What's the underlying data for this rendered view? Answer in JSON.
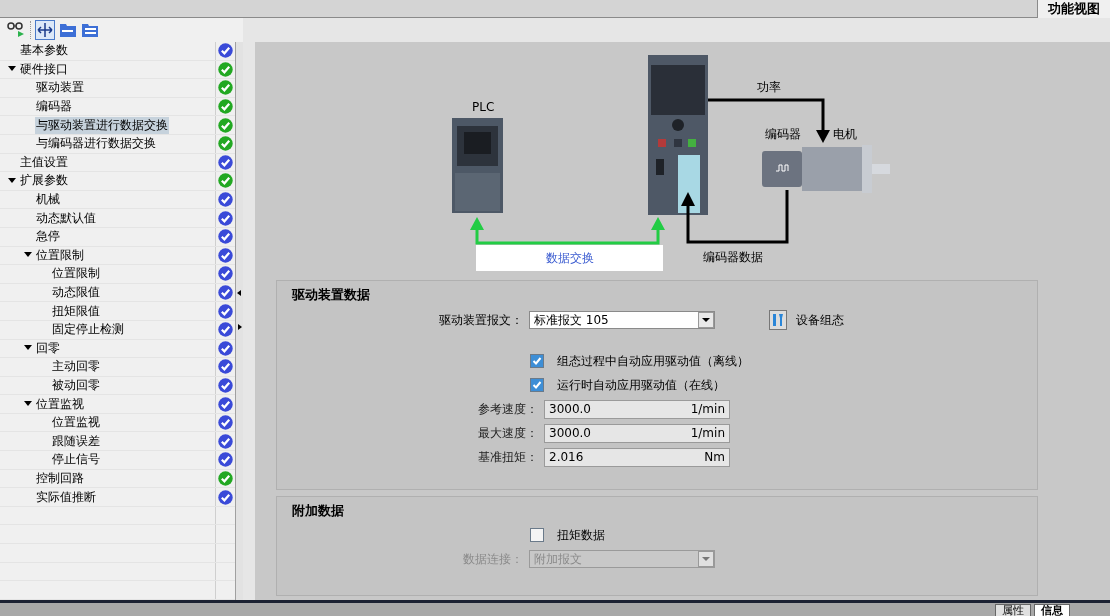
{
  "view_tab": {
    "label": "功能视图",
    "selected": true
  },
  "tree": [
    {
      "label": "基本参数",
      "color": "#3a4ad8",
      "selected": false
    },
    {
      "label": "硬件接口",
      "color": "#22a822",
      "selected": false,
      "expanded": true,
      "children": [
        {
          "label": "驱动装置",
          "color": "#22a822",
          "selected": false
        },
        {
          "label": "编码器",
          "color": "#22a822",
          "selected": false
        },
        {
          "label": "与驱动装置进行数据交换",
          "color": "#22a822",
          "selected": true
        },
        {
          "label": "与编码器进行数据交换",
          "color": "#22a822",
          "selected": false
        }
      ]
    },
    {
      "label": "主值设置",
      "color": "#3a4ad8",
      "selected": false
    },
    {
      "label": "扩展参数",
      "color": "#22a822",
      "selected": false,
      "expanded": true,
      "children": [
        {
          "label": "机械",
          "color": "#3a4ad8",
          "selected": false
        },
        {
          "label": "动态默认值",
          "color": "#3a4ad8",
          "selected": false
        },
        {
          "label": "急停",
          "color": "#3a4ad8",
          "selected": false
        },
        {
          "label": "位置限制",
          "color": "#3a4ad8",
          "selected": false,
          "expanded": true,
          "children": [
            {
              "label": "位置限制",
              "color": "#3a4ad8",
              "selected": false
            },
            {
              "label": "动态限值",
              "color": "#3a4ad8",
              "selected": false
            },
            {
              "label": "扭矩限值",
              "color": "#3a4ad8",
              "selected": false
            },
            {
              "label": "固定停止检测",
              "color": "#3a4ad8",
              "selected": false
            }
          ]
        },
        {
          "label": "回零",
          "color": "#3a4ad8",
          "selected": false,
          "expanded": true,
          "children": [
            {
              "label": "主动回零",
              "color": "#3a4ad8",
              "selected": false
            },
            {
              "label": "被动回零",
              "color": "#3a4ad8",
              "selected": false
            }
          ]
        },
        {
          "label": "位置监视",
          "color": "#3a4ad8",
          "selected": false,
          "expanded": true,
          "children": [
            {
              "label": "位置监视",
              "color": "#3a4ad8",
              "selected": false
            },
            {
              "label": "跟随误差",
              "color": "#3a4ad8",
              "selected": false
            },
            {
              "label": "停止信号",
              "color": "#3a4ad8",
              "selected": false
            }
          ]
        },
        {
          "label": "控制回路",
          "color": "#22a822",
          "selected": false
        },
        {
          "label": "实际值推断",
          "color": "#3a4ad8",
          "selected": false
        }
      ]
    }
  ],
  "diagram": {
    "plc_label": "PLC",
    "power_label": "功率",
    "encoder_label": "编码器",
    "motor_label": "电机",
    "encoder_data_label": "编码器数据",
    "data_exchange_label": "数据交换"
  },
  "drive_data": {
    "title": "驱动装置数据",
    "telegram": {
      "label": "驱动装置报文：",
      "value": "标准报文 105"
    },
    "device_config": "设备组态",
    "checkboxes": [
      {
        "label": "组态过程中自动应用驱动值（离线）",
        "checked": true
      },
      {
        "label": "运行时自动应用驱动值（在线）",
        "checked": true
      }
    ],
    "fields": [
      {
        "label": "参考速度：",
        "value": "3000.0",
        "unit": "1/min"
      },
      {
        "label": "最大速度：",
        "value": "3000.0",
        "unit": "1/min"
      },
      {
        "label": "基准扭矩：",
        "value": "2.016",
        "unit": "Nm"
      }
    ]
  },
  "additional_data": {
    "title": "附加数据",
    "torque_checkbox": {
      "label": "扭矩数据",
      "checked": false
    },
    "data_link": {
      "label": "数据连接：",
      "value": "附加报文",
      "disabled": true
    }
  },
  "bottom_tabs": [
    {
      "label": "属性",
      "selected": false
    },
    {
      "label": "信息",
      "selected": true
    }
  ]
}
